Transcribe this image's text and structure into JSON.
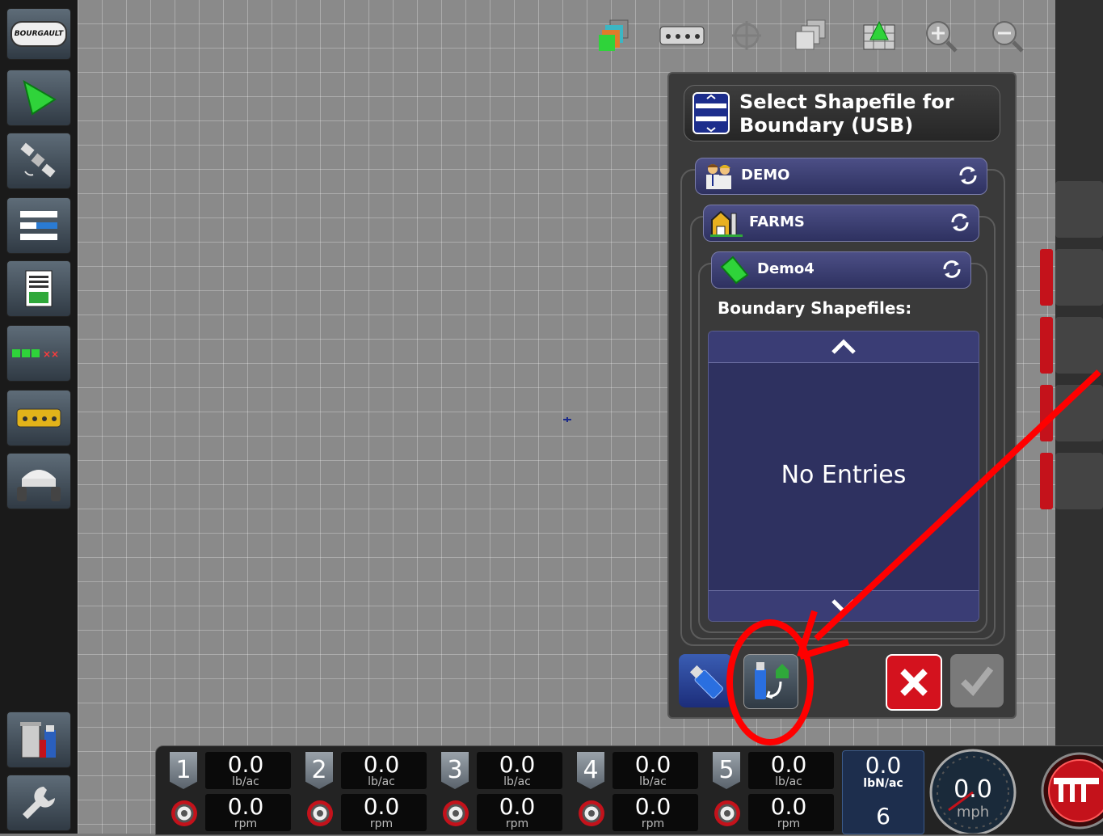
{
  "brand": {
    "logo_text": "BOURGAULT"
  },
  "dialog": {
    "title": "Select Shapefile for Boundary (USB)",
    "client": "DEMO",
    "farm": "FARMS",
    "field": "Demo4",
    "section_label": "Boundary Shapefiles:",
    "empty_text": "No Entries"
  },
  "sections": [
    {
      "number": "1",
      "rate": "0.0",
      "rate_unit": "lb/ac",
      "speed": "0.0",
      "speed_unit": "rpm"
    },
    {
      "number": "2",
      "rate": "0.0",
      "rate_unit": "lb/ac",
      "speed": "0.0",
      "speed_unit": "rpm"
    },
    {
      "number": "3",
      "rate": "0.0",
      "rate_unit": "lb/ac",
      "speed": "0.0",
      "speed_unit": "rpm"
    },
    {
      "number": "4",
      "rate": "0.0",
      "rate_unit": "lb/ac",
      "speed": "0.0",
      "speed_unit": "rpm"
    },
    {
      "number": "5",
      "rate": "0.0",
      "rate_unit": "lb/ac",
      "speed": "0.0",
      "speed_unit": "rpm"
    }
  ],
  "summary": {
    "value": "0.0",
    "unit": "lbN/ac",
    "count": "6"
  },
  "speedometer": {
    "value": "0.0",
    "unit": "mph"
  },
  "colors": {
    "accent_red": "#c4121b",
    "dialog_blue": "#2e3160",
    "annotation_red": "#ff0000"
  }
}
